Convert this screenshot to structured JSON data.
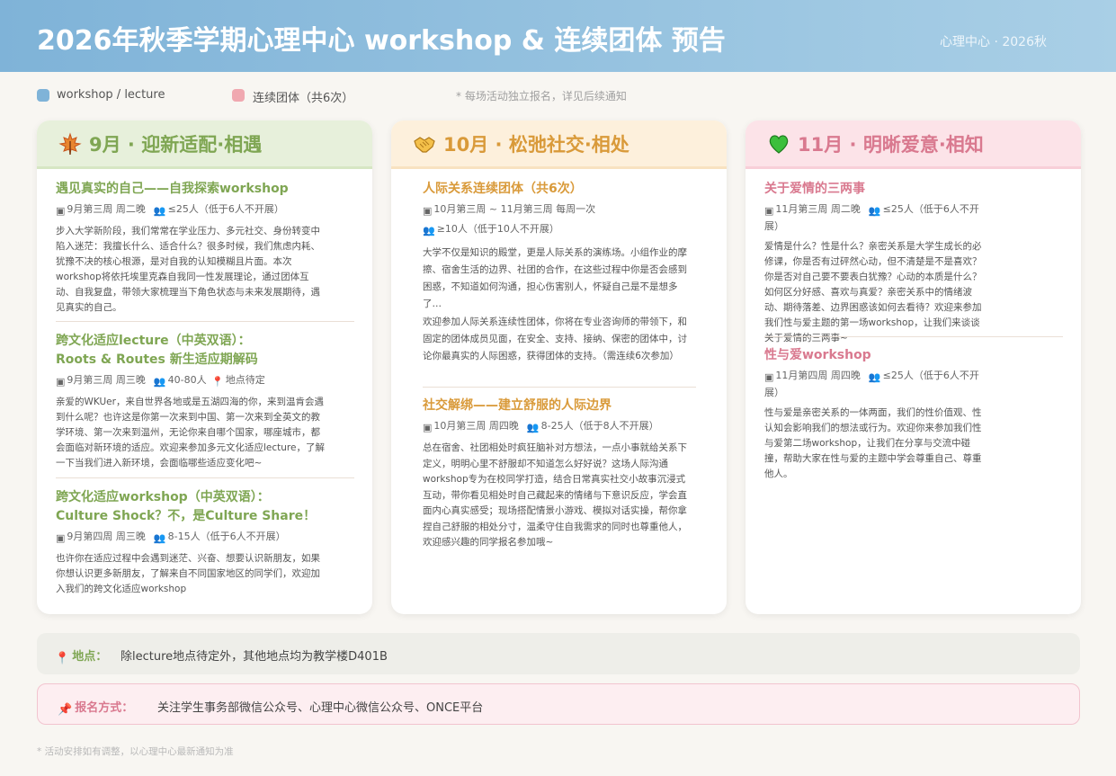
{
  "header": {
    "title": "2026年秋季学期心理中心 workshop & 连续团体 预告",
    "subtitle": "心理中心 · 2026秋"
  },
  "legend": {
    "items": [
      {
        "label": "workshop / lecture",
        "color": "#7fb3d8"
      },
      {
        "label": "连续团体（共6次）",
        "color": "#f0a8b0"
      }
    ],
    "note": "* 每场活动独立报名，详见后续通知"
  },
  "columns": [
    {
      "title": "9月 · 迎新适配·相遇",
      "icon": "maple-leaf-icon",
      "events": [
        {
          "title": "遇见真实的自己——自我探索workshop",
          "date": "9月第三周 周二晚",
          "capacity": "≤25人（低于6人不开展）",
          "desc": "步入大学新阶段，我们常常在学业压力、多元社交、身份转变中陷入迷茫：我擅长什么、适合什么？很多时候，我们焦虑内耗、犹豫不决的核心根源，是对自我的认知模糊且片面。本次workshop将依托埃里克森自我同一性发展理论，通过团体互动、自我复盘，带领大家梳理当下角色状态与未来发展期待，遇见真实的自己。"
        },
        {
          "title_line1": "跨文化适应lecture（中英双语）：",
          "title_line2": "Roots & Routes 新生适应期解码",
          "date": "9月第三周 周三晚",
          "capacity": "40-80人",
          "location": "地点待定",
          "desc": "亲爱的WKUer，来自世界各地或是五湖四海的你，来到温肯会遇到什么呢？也许这是你第一次来到中国、第一次来到全英文的教学环境、第一次来到温州，无论你来自哪个国家，哪座城市，都会面临对新环境的适应。欢迎来参加多元文化适应lecture，了解一下当我们进入新环境，会面临哪些适应变化吧~"
        },
        {
          "title_line1": "跨文化适应workshop（中英双语）：",
          "title_line2": "Culture Shock？不，是Culture Share！",
          "date": "9月第四周 周三晚",
          "capacity": "8-15人（低于6人不开展）",
          "desc": "也许你在适应过程中会遇到迷茫、兴奋、想要认识新朋友，如果你想认识更多新朋友，了解来自不同国家地区的同学们，欢迎加入我们的跨文化适应workshop"
        }
      ]
    },
    {
      "title": "10月 · 松弛社交·相处",
      "icon": "handshake-icon",
      "events": [
        {
          "title": "人际关系连续团体（共6次）",
          "date": "10月第三周 ~ 11月第三周 每周一次",
          "capacity": "≥10人（低于10人不开展）",
          "desc1": "大学不仅是知识的殿堂，更是人际关系的演练场。小组作业的摩擦、宿舍生活的边界、社团的合作，在这些过程中你是否会感到困惑，不知道如何沟通，担心伤害别人，怀疑自己是不是想多了…",
          "desc2": "欢迎参加人际关系连续性团体，你将在专业咨询师的带领下，和固定的团体成员见面，在安全、支持、接纳、保密的团体中，讨论你最真实的人际困惑，获得团体的支持。（需连续6次参加）"
        },
        {
          "title": "社交解绑——建立舒服的人际边界",
          "date": "10月第三周 周四晚",
          "capacity": "8-25人（低于8人不开展）",
          "desc": "总在宿舍、社团相处时疯狂脑补对方想法，一点小事就给关系下定义，明明心里不舒服却不知道怎么好好说？这场人际沟通workshop专为在校同学打造，结合日常真实社交小故事沉浸式互动，带你看见相处时自己藏起来的情绪与下意识反应，学会直面内心真实感受；现场搭配情景小游戏、模拟对话实操，帮你拿捏自己舒服的相处分寸，温柔守住自我需求的同时也尊重他人，欢迎感兴趣的同学报名参加哦~"
        }
      ]
    },
    {
      "title": "11月 · 明晰爱意·相知",
      "icon": "green-heart-icon",
      "events": [
        {
          "title": "关于爱情的三两事",
          "date": "11月第三周 周二晚",
          "capacity": "≤25人（低于6人不开展）",
          "desc": "爱情是什么？性是什么？亲密关系是大学生成长的必修课，你是否有过砰然心动，但不清楚是不是喜欢？你是否对自己要不要表白犹豫？心动的本质是什么？如何区分好感、喜欢与真爱？亲密关系中的情绪波动、期待落差、边界困惑该如何去看待？欢迎来参加我们性与爱主题的第一场workshop，让我们来谈谈关于爱情的三两事~"
        },
        {
          "title": "性与爱workshop",
          "date": "11月第四周 周四晚",
          "capacity": "≤25人（低于6人不开展）",
          "desc": "性与爱是亲密关系的一体两面，我们的性价值观、性认知会影响我们的想法或行为。欢迎你来参加我们性与爱第二场workshop，让我们在分享与交流中碰撞，帮助大家在性与爱的主题中学会尊重自己、尊重他人。"
        }
      ]
    }
  ],
  "location": {
    "label": "地点：",
    "value": "除lecture地点待定外，其他地点均为教学楼D401B"
  },
  "registration": {
    "label": "报名方式：",
    "value": "关注学生事务部微信公众号、心理中心微信公众号、ONCE平台"
  },
  "footnote": "* 活动安排如有调整，以心理中心最新通知为准",
  "colors": {
    "green": "#7fa653",
    "orange": "#d99a3a",
    "pink": "#d9798f",
    "header": "#7fb3d8"
  }
}
